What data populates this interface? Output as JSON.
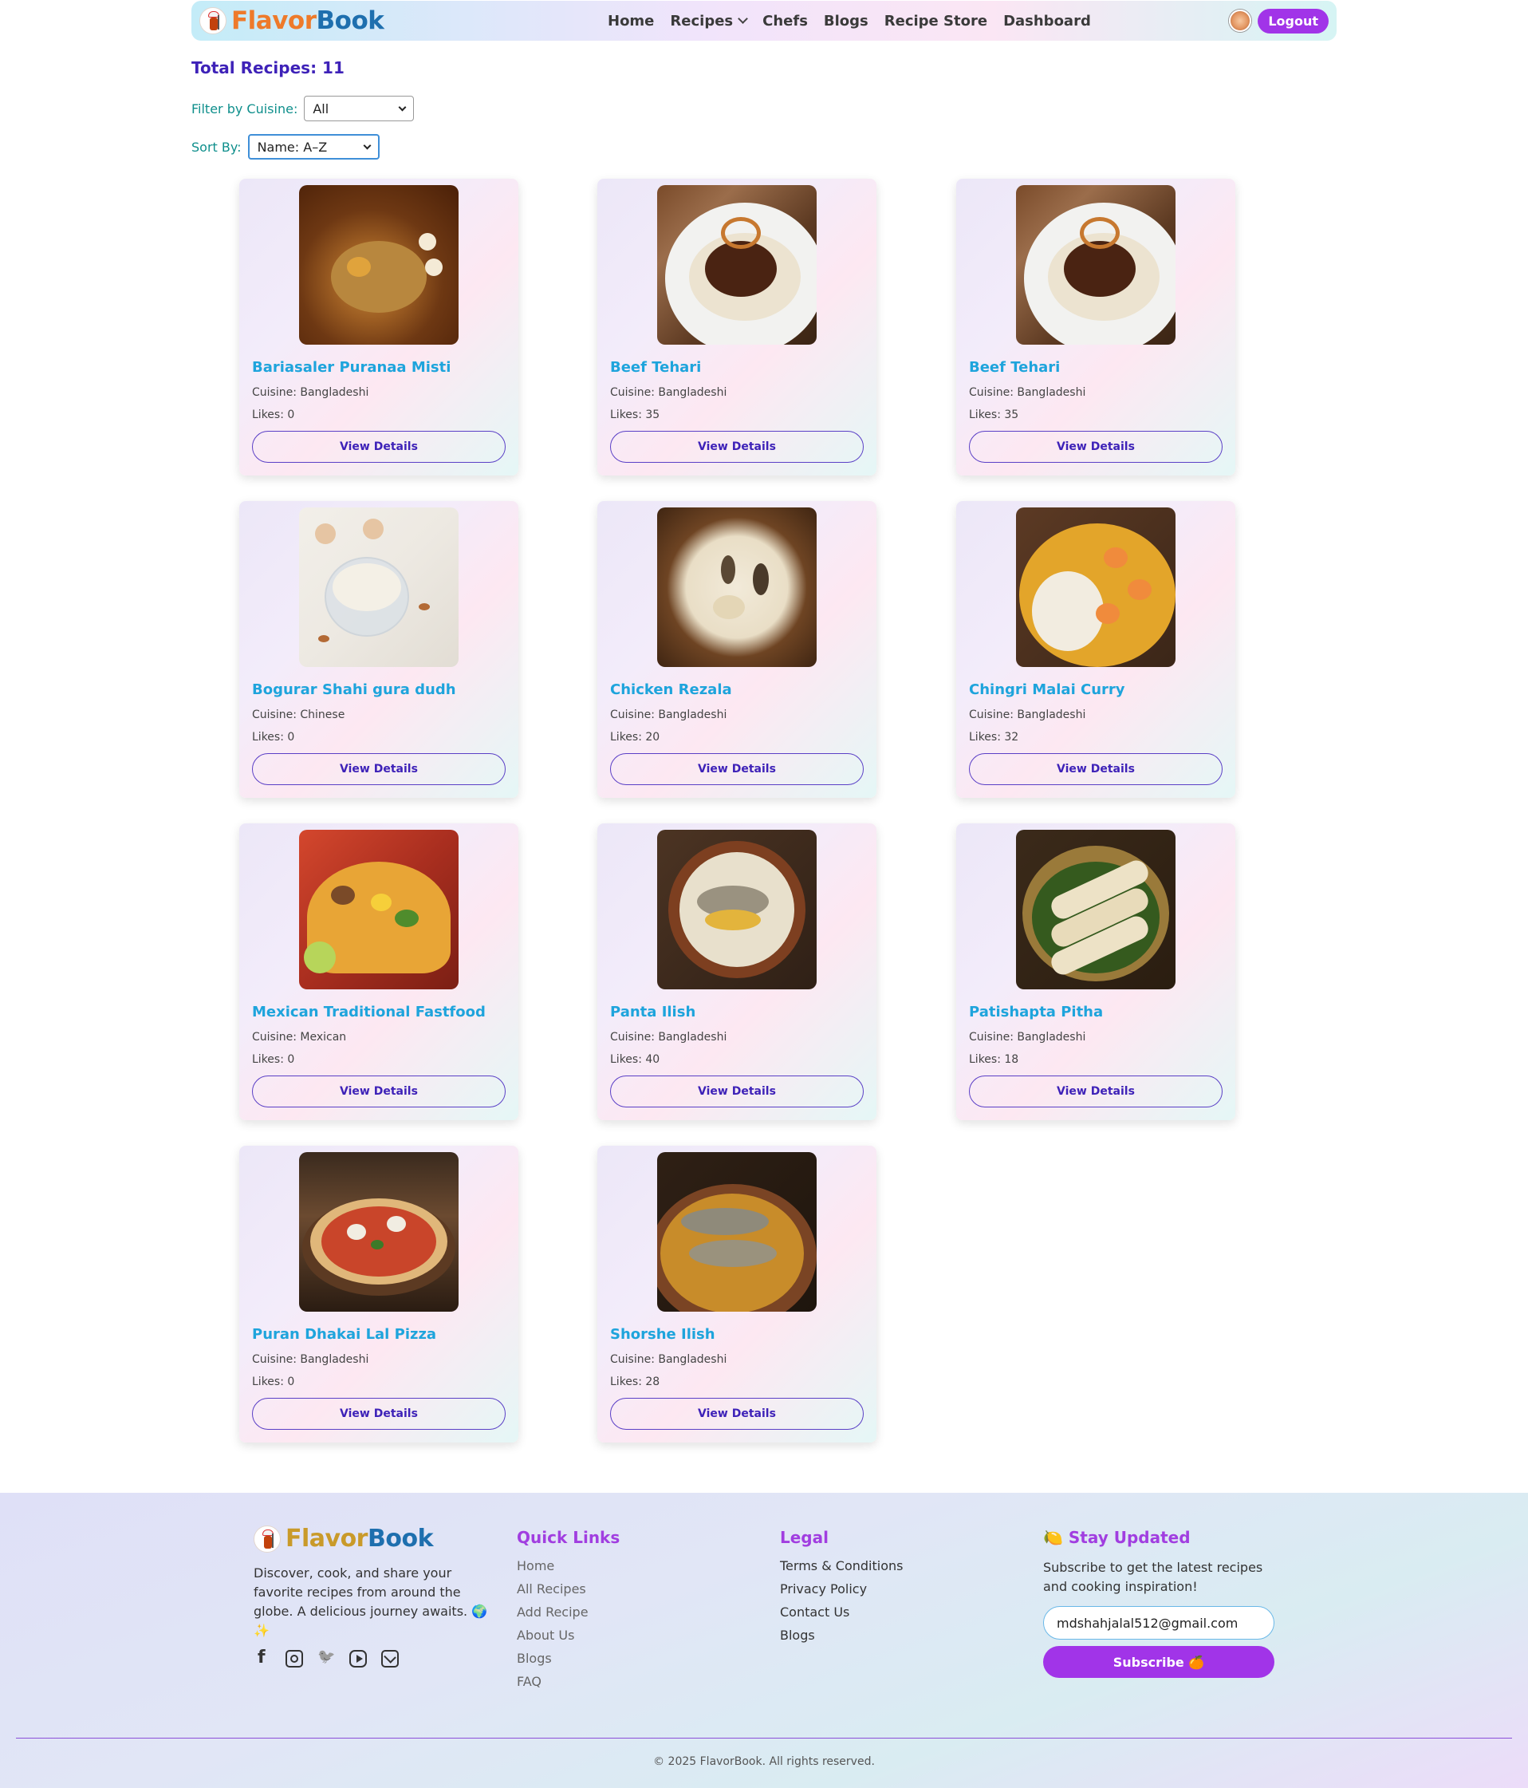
{
  "brand": {
    "flavor": "Flavor",
    "book": "Book"
  },
  "nav": {
    "links": [
      "Home",
      "Recipes",
      "Chefs",
      "Blogs",
      "Recipe Store",
      "Dashboard"
    ],
    "logout_label": "Logout"
  },
  "controls": {
    "total_label": "Total Recipes: 11",
    "filter_label": "Filter by Cuisine:",
    "filter_value": "All",
    "sort_label": "Sort By:",
    "sort_value": "Name: A–Z"
  },
  "recipes": [
    {
      "title": "Bariasaler Puranaa Misti",
      "cuisine": "Cuisine: Bangladeshi",
      "likes": "Likes: 0",
      "button": "View Details"
    },
    {
      "title": "Beef Tehari",
      "cuisine": "Cuisine: Bangladeshi",
      "likes": "Likes: 35",
      "button": "View Details"
    },
    {
      "title": "Beef Tehari",
      "cuisine": "Cuisine: Bangladeshi",
      "likes": "Likes: 35",
      "button": "View Details"
    },
    {
      "title": "Bogurar Shahi gura dudh",
      "cuisine": "Cuisine: Chinese",
      "likes": "Likes: 0",
      "button": "View Details"
    },
    {
      "title": "Chicken Rezala",
      "cuisine": "Cuisine: Bangladeshi",
      "likes": "Likes: 20",
      "button": "View Details"
    },
    {
      "title": "Chingri Malai Curry",
      "cuisine": "Cuisine: Bangladeshi",
      "likes": "Likes: 32",
      "button": "View Details"
    },
    {
      "title": "Mexican Traditional Fastfood",
      "cuisine": "Cuisine: Mexican",
      "likes": "Likes: 0",
      "button": "View Details"
    },
    {
      "title": "Panta Ilish",
      "cuisine": "Cuisine: Bangladeshi",
      "likes": "Likes: 40",
      "button": "View Details"
    },
    {
      "title": "Patishapta Pitha",
      "cuisine": "Cuisine: Bangladeshi",
      "likes": "Likes: 18",
      "button": "View Details"
    },
    {
      "title": "Puran Dhakai Lal Pizza",
      "cuisine": "Cuisine: Bangladeshi",
      "likes": "Likes: 0",
      "button": "View Details"
    },
    {
      "title": "Shorshe Ilish",
      "cuisine": "Cuisine: Bangladeshi",
      "likes": "Likes: 28",
      "button": "View Details"
    }
  ],
  "footer": {
    "description": "Discover, cook, and share your favorite recipes from around the globe. A delicious journey awaits. 🌍✨",
    "quick_links_heading": "Quick Links",
    "quick_links": [
      "Home",
      "All Recipes",
      "Add Recipe",
      "About Us",
      "Blogs",
      "FAQ"
    ],
    "legal_heading": "Legal",
    "legal_links": [
      "Terms & Conditions",
      "Privacy Policy",
      "Contact Us",
      "Blogs"
    ],
    "stay_heading": "🍋 Stay Updated",
    "stay_desc": "Subscribe to get the latest recipes and cooking inspiration!",
    "email_value": "mdshahjalal512@gmail.com",
    "subscribe_label": "Subscribe 🍊",
    "copyright": "© 2025 FlavorBook. All rights reserved."
  },
  "colors": {
    "accent_purple": "#a134e8",
    "title_cyan": "#1ea4dc",
    "total_indigo": "#3e22b8",
    "label_teal": "#0f8f8c"
  }
}
